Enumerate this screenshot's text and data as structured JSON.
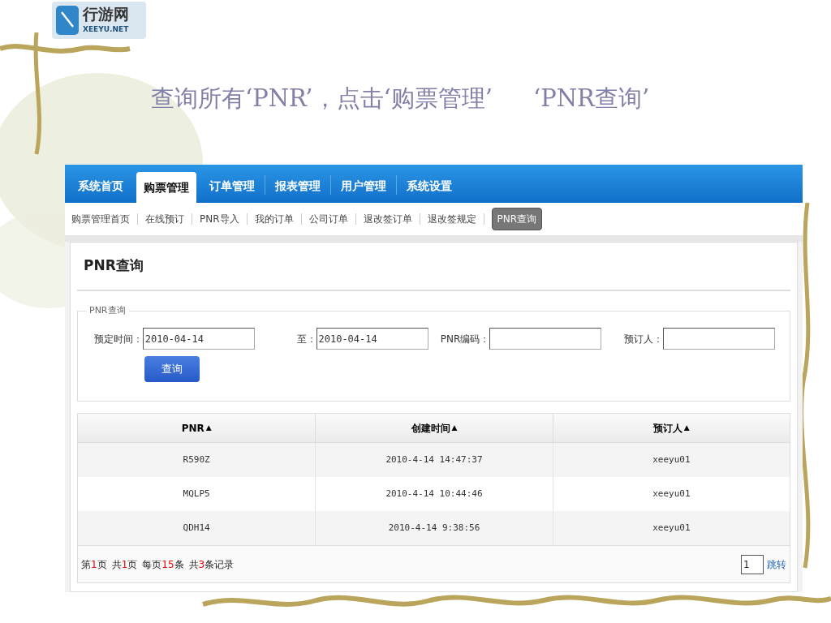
{
  "logo": {
    "name": "行游网",
    "domain": "XEEYU.NET"
  },
  "slide_title": [
    "查询所有‘PNR’，点击‘购票管理’",
    "‘PNR查询’"
  ],
  "nav": [
    {
      "label": "系统首页",
      "selected": false
    },
    {
      "label": "购票管理",
      "selected": true
    },
    {
      "label": "订单管理",
      "selected": false
    },
    {
      "label": "报表管理",
      "selected": false
    },
    {
      "label": "用户管理",
      "selected": false
    },
    {
      "label": "系统设置",
      "selected": false
    }
  ],
  "subnav": [
    {
      "label": "购票管理首页",
      "selected": false
    },
    {
      "label": "在线预订",
      "selected": false
    },
    {
      "label": "PNR导入",
      "selected": false
    },
    {
      "label": "我的订单",
      "selected": false
    },
    {
      "label": "公司订单",
      "selected": false
    },
    {
      "label": "退改签订单",
      "selected": false
    },
    {
      "label": "退改签规定",
      "selected": false
    },
    {
      "label": "PNR查询",
      "selected": true
    }
  ],
  "panel_title": "PNR查询",
  "fieldset": {
    "legend": "PNR查询",
    "fields": [
      {
        "label": "预定时间：",
        "value": "2010-04-14"
      },
      {
        "label": "至：",
        "value": "2010-04-14"
      },
      {
        "label": "PNR编码："
      },
      {
        "label": "预订人："
      }
    ],
    "button": "查询"
  },
  "table": {
    "columns": [
      {
        "label": "PNR",
        "sort": "▲"
      },
      {
        "label": "创建时间",
        "sort": "▲"
      },
      {
        "label": "预订人",
        "sort": "▲"
      }
    ],
    "rows": [
      [
        "R590Z",
        "2010-4-14 14:47:37",
        "xeeyu01"
      ],
      [
        "MQLP5",
        "2010-4-14 10:44:46",
        "xeeyu01"
      ],
      [
        "QDH14",
        "2010-4-14 9:38:56",
        "xeeyu01"
      ]
    ]
  },
  "pager": {
    "parts": [
      {
        "pre": "第",
        "num": "1",
        "post": "页"
      },
      {
        "pre": "共",
        "num": "1",
        "post": "页"
      },
      {
        "pre": "每页",
        "num": "15",
        "post": "条"
      },
      {
        "pre": "共",
        "num": "3",
        "post": "条记录"
      }
    ],
    "page_input": "1",
    "jump": "跳转"
  }
}
